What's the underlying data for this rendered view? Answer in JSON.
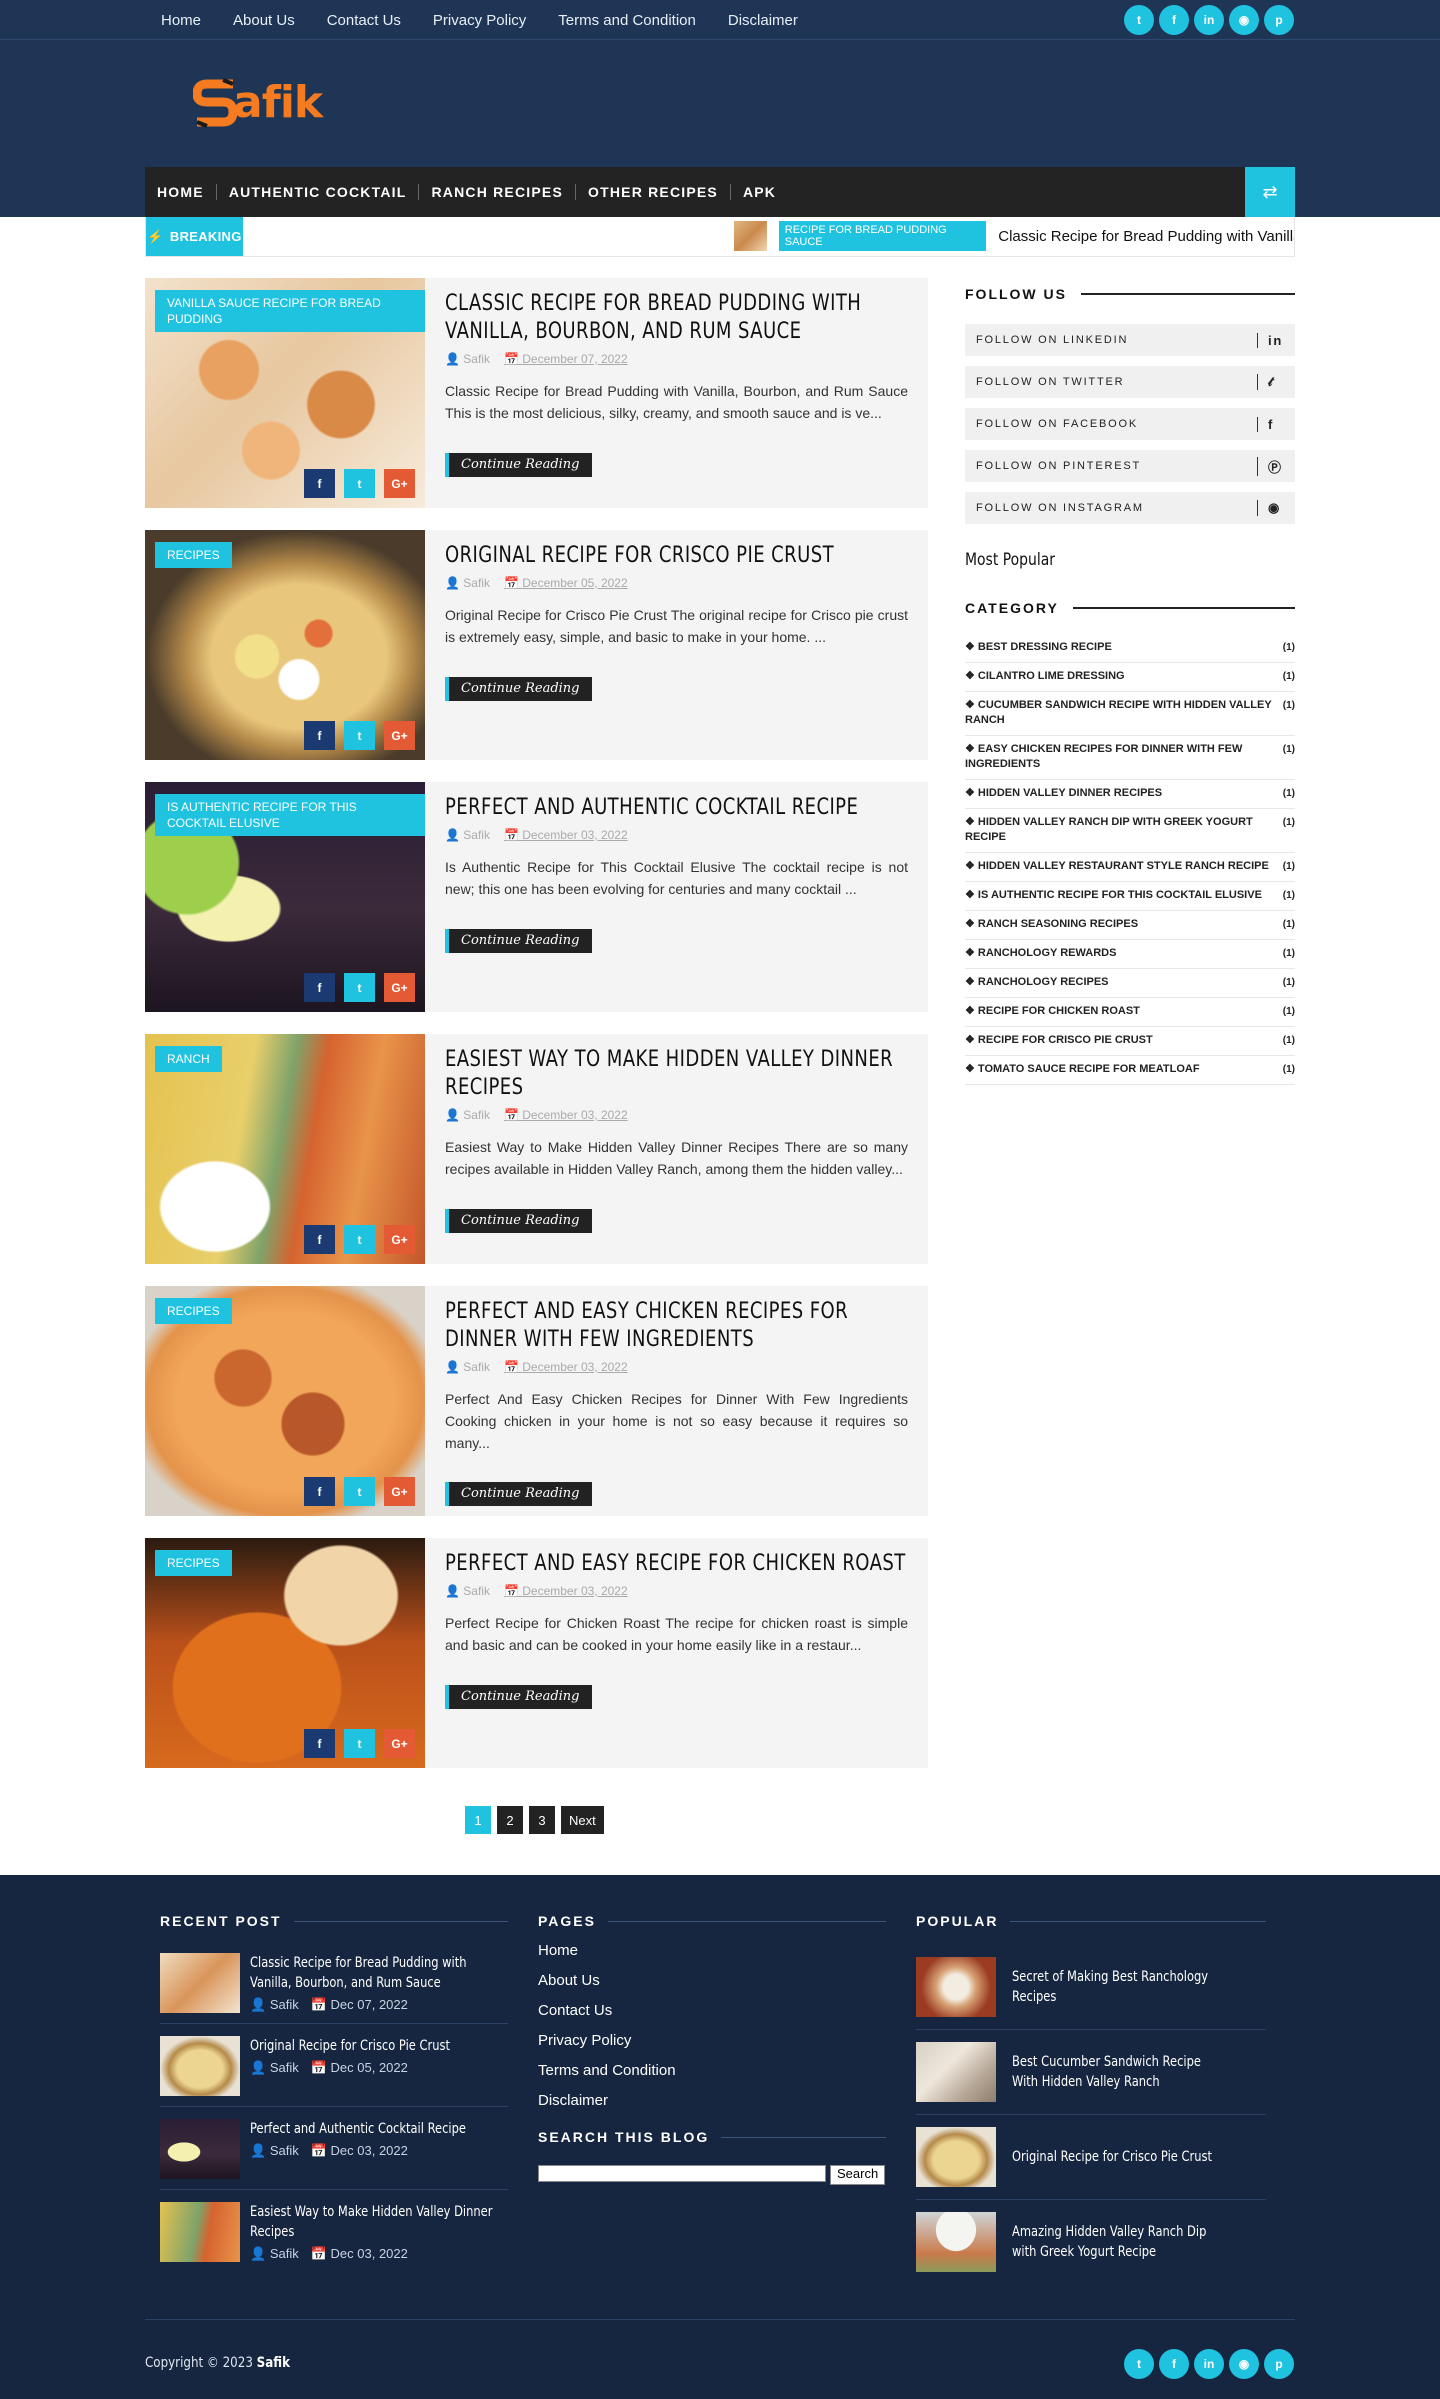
{
  "topbar": {
    "menu": [
      "Home",
      "About Us",
      "Contact Us",
      "Privacy Policy",
      "Terms and Condition",
      "Disclaimer"
    ],
    "social": [
      "twitter-icon",
      "facebook-icon",
      "linkedin-icon",
      "instagram-icon",
      "pinterest-icon"
    ]
  },
  "logo": {
    "text": "afik"
  },
  "nav": {
    "items": [
      "HOME",
      "AUTHENTIC COCKTAIL",
      "RANCH RECIPES",
      "OTHER RECIPES",
      "APK"
    ]
  },
  "ticker": {
    "label": "BREAKING",
    "category": "RECIPE FOR BREAD PUDDING SAUCE",
    "title": "Classic Recipe for Bread Pudding with Vanilla, Bourbon, and Rum Sauce"
  },
  "posts": [
    {
      "label": "VANILLA SAUCE RECIPE FOR BREAD PUDDING",
      "title": "Classic Recipe for Bread Pudding with Vanilla, Bourbon, and Rum Sauce",
      "author": "Safik",
      "date": "December 07, 2022",
      "excerpt": "Classic Recipe for Bread Pudding with Vanilla, Bourbon, and Rum Sauce This is the most delicious, silky, creamy, and smooth sauce and is ve...",
      "readmore": "Continue Reading"
    },
    {
      "label": "RECIPES",
      "title": "Original Recipe for Crisco Pie Crust",
      "author": "Safik",
      "date": "December 05, 2022",
      "excerpt": "Original Recipe for Crisco Pie Crust The original recipe for Crisco pie crust is extremely easy, simple, and basic to make in your home. ...",
      "readmore": "Continue Reading"
    },
    {
      "label": "IS AUTHENTIC RECIPE FOR THIS COCKTAIL ELUSIVE",
      "title": "Perfect and Authentic Cocktail Recipe",
      "author": "Safik",
      "date": "December 03, 2022",
      "excerpt": "Is Authentic Recipe for This Cocktail Elusive  The cocktail recipe is not new; this one has been evolving for centuries and many cocktail ...",
      "readmore": "Continue Reading"
    },
    {
      "label": "RANCH",
      "title": "Easiest Way to Make Hidden Valley Dinner Recipes",
      "author": "Safik",
      "date": "December 03, 2022",
      "excerpt": "Easiest Way to Make Hidden Valley Dinner Recipes There are so many recipes available in Hidden Valley Ranch, among them the hidden valley...",
      "readmore": "Continue Reading"
    },
    {
      "label": "RECIPES",
      "title": "Perfect and Easy Chicken Recipes for Dinner with Few Ingredients",
      "author": "Safik",
      "date": "December 03, 2022",
      "excerpt": "Perfect And Easy Chicken Recipes for Dinner With Few Ingredients Cooking chicken in your home is not so easy because it requires so many...",
      "readmore": "Continue Reading"
    },
    {
      "label": "RECIPES",
      "title": "Perfect and Easy Recipe for Chicken Roast",
      "author": "Safik",
      "date": "December 03, 2022",
      "excerpt": "Perfect Recipe for Chicken Roast The recipe for chicken roast is simple and basic and can be cooked in your home easily like in a restaur...",
      "readmore": "Continue Reading"
    }
  ],
  "pager": {
    "pages": [
      "1",
      "2",
      "3"
    ],
    "next": "Next"
  },
  "sidebar": {
    "follow_title": "FOLLOW US",
    "follow": [
      {
        "label": "FOLLOW ON LINKEDIN",
        "icon": "in"
      },
      {
        "label": "FOLLOW ON TWITTER",
        "icon": "t"
      },
      {
        "label": "FOLLOW ON FACEBOOK",
        "icon": "f"
      },
      {
        "label": "FOLLOW ON PINTEREST",
        "icon": "p"
      },
      {
        "label": "FOLLOW ON INSTAGRAM",
        "icon": "ig"
      }
    ],
    "most_popular": "Most Popular",
    "category_title": "CATEGORY",
    "categories": [
      {
        "name": "BEST DRESSING RECIPE",
        "count": "(1)"
      },
      {
        "name": "CILANTRO LIME DRESSING",
        "count": "(1)"
      },
      {
        "name": "CUCUMBER SANDWICH RECIPE WITH HIDDEN VALLEY RANCH",
        "count": "(1)"
      },
      {
        "name": "EASY CHICKEN RECIPES FOR DINNER WITH FEW INGREDIENTS",
        "count": "(1)"
      },
      {
        "name": "HIDDEN VALLEY DINNER RECIPES",
        "count": "(1)"
      },
      {
        "name": "HIDDEN VALLEY RANCH DIP WITH GREEK YOGURT RECIPE",
        "count": "(1)"
      },
      {
        "name": "HIDDEN VALLEY RESTAURANT STYLE RANCH RECIPE",
        "count": "(1)"
      },
      {
        "name": "IS AUTHENTIC RECIPE FOR THIS COCKTAIL ELUSIVE",
        "count": "(1)"
      },
      {
        "name": "RANCH SEASONING RECIPES",
        "count": "(1)"
      },
      {
        "name": "RANCHOLOGY REWARDS",
        "count": "(1)"
      },
      {
        "name": "RANCHOLOGY RECIPES",
        "count": "(1)"
      },
      {
        "name": "RECIPE FOR CHICKEN ROAST",
        "count": "(1)"
      },
      {
        "name": "RECIPE FOR CRISCO PIE CRUST",
        "count": "(1)"
      },
      {
        "name": "TOMATO SAUCE RECIPE FOR MEATLOAF",
        "count": "(1)"
      }
    ]
  },
  "footer": {
    "recent_title": "RECENT POST",
    "recent": [
      {
        "title": "Classic Recipe for Bread Pudding with Vanilla, Bourbon, and Rum Sauce",
        "author": "Safik",
        "date": "Dec 07, 2022"
      },
      {
        "title": "Original Recipe for Crisco Pie Crust",
        "author": "Safik",
        "date": "Dec 05, 2022"
      },
      {
        "title": "Perfect and Authentic Cocktail Recipe",
        "author": "Safik",
        "date": "Dec 03, 2022"
      },
      {
        "title": "Easiest Way to Make Hidden Valley Dinner Recipes",
        "author": "Safik",
        "date": "Dec 03, 2022"
      }
    ],
    "pages_title": "PAGES",
    "pages": [
      "Home",
      "About Us",
      "Contact Us",
      "Privacy Policy",
      "Terms and Condition",
      "Disclaimer"
    ],
    "search_title": "SEARCH THIS BLOG",
    "search_button": "Search",
    "popular_title": "POPULAR",
    "popular": [
      "Secret of Making Best Ranchology Recipes",
      "Best Cucumber Sandwich Recipe With Hidden Valley Ranch",
      "Original Recipe for Crisco Pie Crust",
      "Amazing Hidden Valley Ranch Dip with Greek Yogurt Recipe"
    ],
    "copyright_prefix": "Copyright © 2023",
    "copyright_name": "Safik"
  },
  "colors": {
    "accent": "#1fc3e0",
    "header_bg": "#1e3556",
    "footer_bg": "#162640",
    "nav_bg": "#232323",
    "logo": "#f47b1f"
  }
}
